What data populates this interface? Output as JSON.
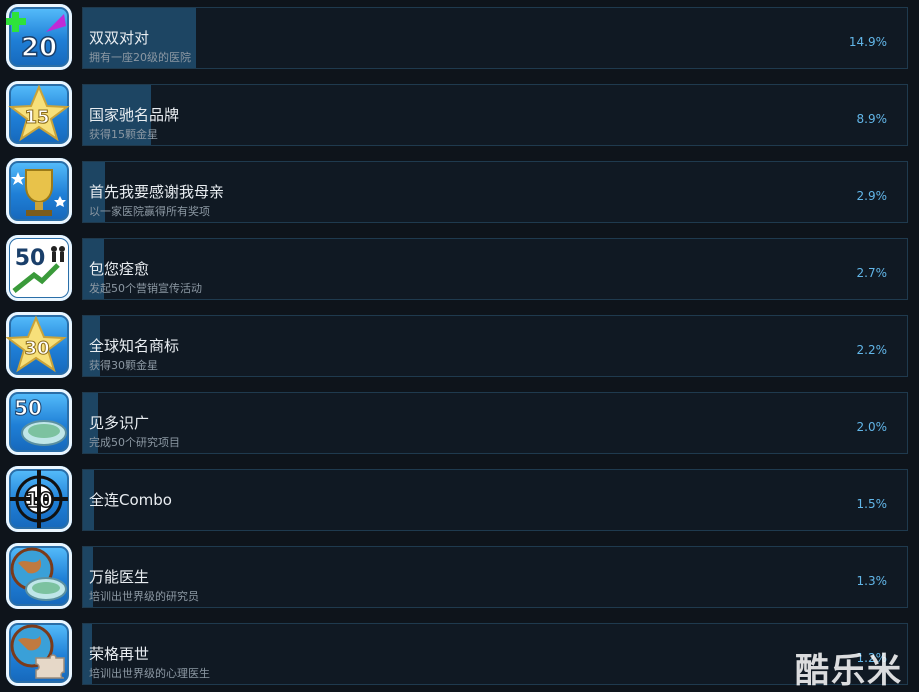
{
  "achievements": [
    {
      "title": "双双对对",
      "description": "拥有一座20级的医院",
      "percent": "14.9%",
      "percent_value": 14.9,
      "icon": "plus-20-arrow-icon"
    },
    {
      "title": "国家驰名品牌",
      "description": "获得15颗金星",
      "percent": "8.9%",
      "percent_value": 8.9,
      "icon": "star-15-icon"
    },
    {
      "title": "首先我要感谢我母亲",
      "description": "以一家医院赢得所有奖项",
      "percent": "2.9%",
      "percent_value": 2.9,
      "icon": "trophy-icon"
    },
    {
      "title": "包您痊愈",
      "description": "发起50个营销宣传活动",
      "percent": "2.7%",
      "percent_value": 2.7,
      "icon": "campaign-50-icon"
    },
    {
      "title": "全球知名商标",
      "description": "获得30颗金星",
      "percent": "2.2%",
      "percent_value": 2.2,
      "icon": "star-30-icon"
    },
    {
      "title": "见多识广",
      "description": "完成50个研究项目",
      "percent": "2.0%",
      "percent_value": 2.0,
      "icon": "petri-dish-50-icon"
    },
    {
      "title": "全连Combo",
      "description": "",
      "percent": "1.5%",
      "percent_value": 1.5,
      "icon": "crosshair-10-icon"
    },
    {
      "title": "万能医生",
      "description": "培训出世界级的研究员",
      "percent": "1.3%",
      "percent_value": 1.3,
      "icon": "globe-petri-dish-icon"
    },
    {
      "title": "荣格再世",
      "description": "培训出世界级的心理医生",
      "percent": "1.2%",
      "percent_value": 1.2,
      "icon": "globe-puzzle-icon"
    }
  ],
  "watermark": "酷乐米",
  "colors": {
    "progress_fill": "#1d4563",
    "percent_text": "#62b6e8",
    "panel_border": "#1f3a4e"
  }
}
